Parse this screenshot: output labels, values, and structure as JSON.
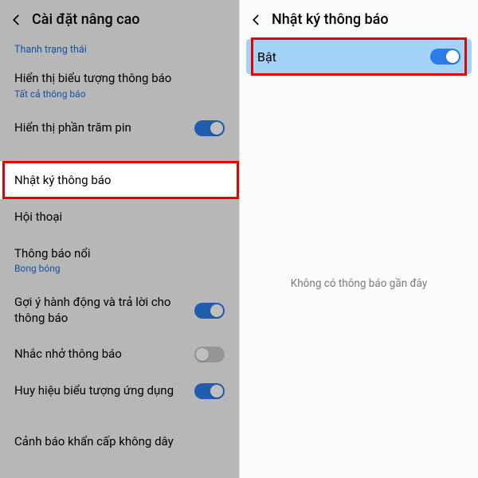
{
  "left": {
    "header_title": "Cài đặt nâng cao",
    "section_status_bar": "Thanh trạng thái",
    "rows": {
      "show_icons_label": "Hiển thị biểu tượng thông báo",
      "show_icons_sub": "Tất cả thông báo",
      "battery_percent_label": "Hiển thị phần trăm pin",
      "notification_history_label": "Nhật ký thông báo",
      "conversations_label": "Hội thoại",
      "floating_label": "Thông báo nổi",
      "floating_sub": "Bong bóng",
      "suggest_actions_label": "Gợi ý hành động và trả lời cho thông báo",
      "remind_label": "Nhắc nhở thông báo",
      "badges_label": "Huy hiệu biểu tượng ứng dụng",
      "wireless_alert_label": "Cảnh báo khẩn cấp không dây"
    }
  },
  "right": {
    "header_title": "Nhật ký thông báo",
    "toggle_label": "Bật",
    "empty_message": "Không có thông báo gần đây"
  },
  "colors": {
    "highlight_border": "#e60000",
    "accent": "#1a6fd4",
    "toggle_on": "#2b7de9"
  }
}
